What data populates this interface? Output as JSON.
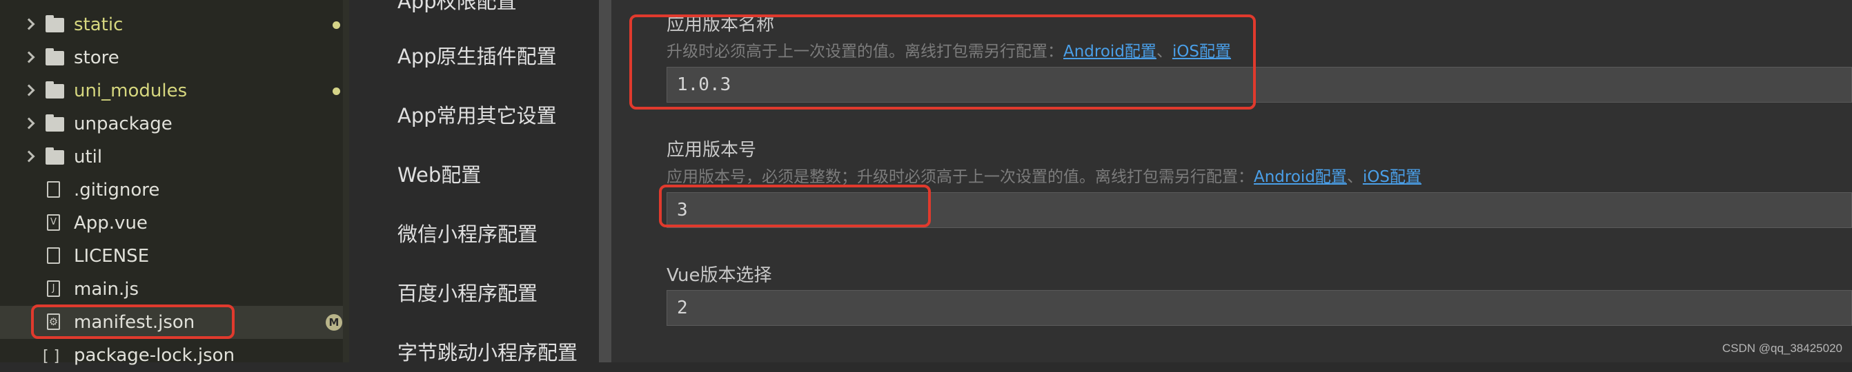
{
  "file_tree": [
    {
      "name": "static",
      "type": "folder",
      "modified": true
    },
    {
      "name": "store",
      "type": "folder",
      "modified": false
    },
    {
      "name": "uni_modules",
      "type": "folder",
      "modified": true
    },
    {
      "name": "unpackage",
      "type": "folder",
      "modified": false
    },
    {
      "name": "util",
      "type": "folder",
      "modified": false
    },
    {
      "name": ".gitignore",
      "type": "file",
      "icon": "file-icon"
    },
    {
      "name": "App.vue",
      "type": "file",
      "icon": "vue-file-icon",
      "glyph": "V"
    },
    {
      "name": "LICENSE",
      "type": "file",
      "icon": "file-icon"
    },
    {
      "name": "main.js",
      "type": "file",
      "icon": "js-file-icon",
      "glyph": "J"
    },
    {
      "name": "manifest.json",
      "type": "file",
      "icon": "gear-file-icon",
      "glyph": "⚙",
      "badge": "M",
      "selected": true
    },
    {
      "name": "package-lock.json",
      "type": "file",
      "icon": "json-file-icon",
      "glyph": "[ ]"
    }
  ],
  "menu": {
    "partial_top": "App权限配置",
    "items": [
      "App原生插件配置",
      "App常用其它设置",
      "Web配置",
      "微信小程序配置",
      "百度小程序配置",
      "字节跳动小程序配置"
    ]
  },
  "fields": {
    "version_name": {
      "label": "应用版本名称",
      "desc": "升级时必须高于上一次设置的值。离线打包需另行配置：",
      "link_android": "Android配置",
      "link_sep": "、",
      "link_ios": "iOS配置",
      "value": "1.0.3"
    },
    "version_code": {
      "label": "应用版本号",
      "desc": "应用版本号，必须是整数；升级时必须高于上一次设置的值。离线打包需另行配置：",
      "link_android": "Android配置",
      "link_sep": "、",
      "link_ios": "iOS配置",
      "value": "3"
    },
    "vue_version": {
      "label": "Vue版本选择",
      "value": "2"
    }
  },
  "colors": {
    "highlight": "#e03a2d",
    "link": "#4a9fe8",
    "modified_text": "#d6d77f"
  },
  "watermark": "CSDN @qq_38425020"
}
